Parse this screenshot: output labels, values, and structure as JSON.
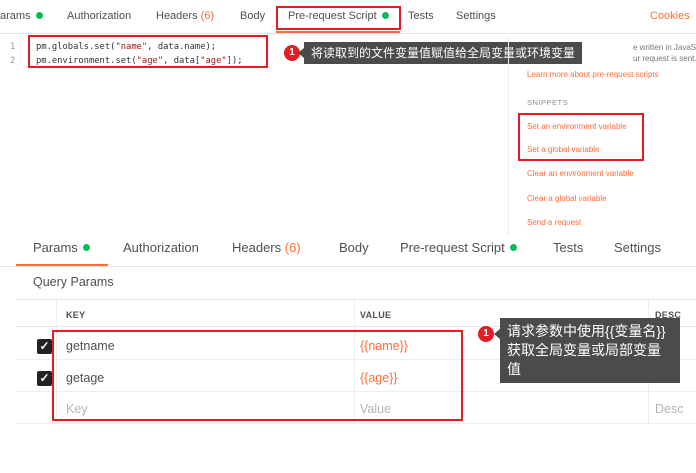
{
  "top_tabs": {
    "params": "arams",
    "authorization": "Authorization",
    "headers": "Headers",
    "headers_count": "(6)",
    "body": "Body",
    "prerequest": "Pre-request Script",
    "tests": "Tests",
    "settings": "Settings",
    "cookies": "Cookies"
  },
  "script": {
    "line1_num": "1",
    "line2_num": "2",
    "line1_a": "pm.globals.set(",
    "line1_str": "\"name\"",
    "line1_b": ", data.name);",
    "line2_a": "pm.environment.set(",
    "line2_str1": "\"age\"",
    "line2_b": ", data[",
    "line2_str2": "\"age\"",
    "line2_c": "]);"
  },
  "callout1": {
    "badge": "1",
    "text": "将读取到的文件变量值赋值给全局变量或环境变量"
  },
  "sidebar": {
    "desc1": "e written in JavaScr",
    "desc2": "ur request is sent.",
    "learn_more": "Learn more about pre-request scripts",
    "snippets_heading": "SNIPPETS",
    "snippets": [
      "Set an environment variable",
      "Set a global variable",
      "Clear an environment variable",
      "Clear a global variable",
      "Send a request"
    ]
  },
  "bottom_tabs": {
    "params": "Params",
    "authorization": "Authorization",
    "headers": "Headers",
    "headers_count": "(6)",
    "body": "Body",
    "prerequest": "Pre-request Script",
    "tests": "Tests",
    "settings": "Settings"
  },
  "query": {
    "title": "Query Params",
    "headers": {
      "key": "KEY",
      "value": "VALUE",
      "desc": "DESC"
    },
    "rows": [
      {
        "key": "getname",
        "value": "{{name}}"
      },
      {
        "key": "getage",
        "value": "{{age}}"
      }
    ],
    "placeholder_key": "Key",
    "placeholder_value": "Value",
    "placeholder_desc": "Desc"
  },
  "callout2": {
    "badge": "1",
    "text": "请求参数中使用{{变量名}}获取全局变量或局部变量值"
  },
  "colors": {
    "accent": "#ff6c37",
    "highlight": "#e51c23",
    "active_dot": "#0cbb52",
    "callout_bg": "#4b4b4b"
  }
}
